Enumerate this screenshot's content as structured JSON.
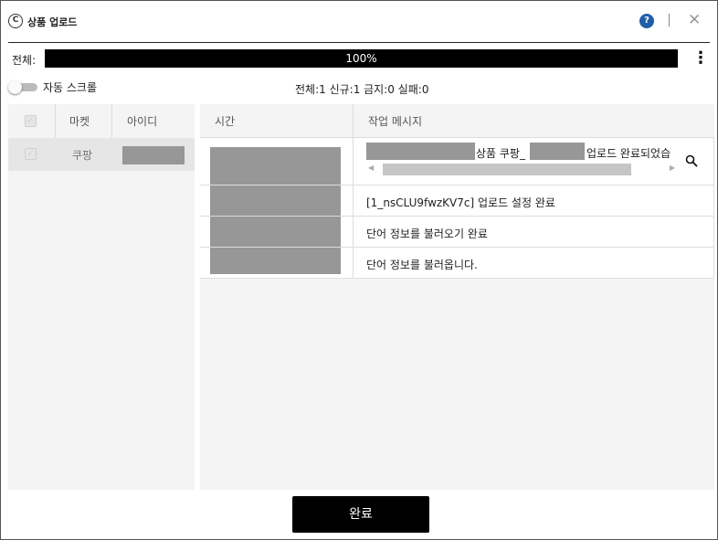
{
  "window": {
    "title": "상품 업로드",
    "logo_icon": "coupang-logo-icon",
    "help_label": "?",
    "close_label": "✕"
  },
  "progress": {
    "label": "전체:",
    "percent": 100,
    "text": "100%",
    "menu_icon": "more-vertical-icon"
  },
  "toolbar": {
    "auto_scroll_label": "자동 스크롤",
    "auto_scroll_on": false,
    "stats": "전체:1 신규:1 금지:0 실패:0"
  },
  "markets_table": {
    "headers": [
      "마켓",
      "아이디"
    ],
    "rows": [
      {
        "market": "쿠팡",
        "id_redacted": true
      }
    ]
  },
  "log_table": {
    "headers": [
      "시간",
      "작업 메시지"
    ],
    "rows": [
      {
        "message_part1": "상품 쿠팡_",
        "message_part2": "업로드 완료되었습",
        "has_search": true
      },
      {
        "message": "[1_nsCLU9fwzKV7c] 업로드 설정 완료"
      },
      {
        "message": "단어 정보를 불러오기 완료"
      },
      {
        "message": "단어 정보를 불러옵니다."
      }
    ]
  },
  "footer": {
    "done_label": "완료"
  },
  "colors": {
    "accent_help": "#1f5fa8",
    "progress_fill": "#000000",
    "redaction": "#979797"
  }
}
